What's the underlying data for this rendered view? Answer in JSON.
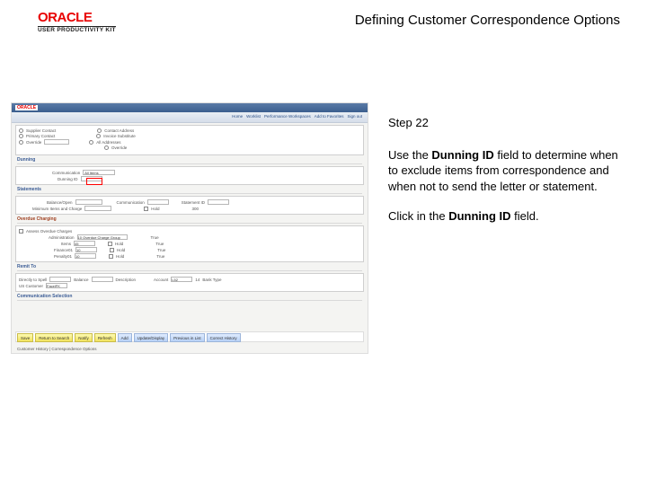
{
  "header": {
    "logo_text": "ORACLE",
    "upk_text": "USER PRODUCTIVITY KIT",
    "page_title": "Defining Customer Correspondence Options"
  },
  "screenshot": {
    "oracle_mini": "ORACLE",
    "nav": [
      "Home",
      "Worklist",
      "Performance Workspaces",
      "Add to Favorites",
      "Sign out"
    ],
    "opts": {
      "supplier_contact": "Supplier Contact",
      "primary_contact": "Primary Contact",
      "override": "Override",
      "contact_address": "Contact Address",
      "invoice_substitute": "Invoice Substitute",
      "all_addresses": "All Addresses",
      "override2": "Override"
    },
    "sect_dunning": "Dunning",
    "dunning": {
      "comm_label": "Communication",
      "comm_value": "All Items",
      "dunning_id_label": "Dunning ID"
    },
    "sect_statements": "Statements",
    "statements": {
      "balance_label": "Balance/Open",
      "comm_label": "Communication",
      "statement_id_label": "Statement ID",
      "items_label": "Minimum Items and Charge",
      "hold_label": "Hold",
      "hold_value": "300"
    },
    "sect_overdue": "Overdue Charging",
    "overdue": {
      "assess_label": "Assess Overdue Charges",
      "admin_label": "Administration",
      "admin_value": "10 Overdue Charge Group",
      "true1": "True",
      "items_label": "Items",
      "items_v": "45",
      "hold": "Hold",
      "true2": "True",
      "finance_label": "Finance01",
      "finance_v": "10",
      "hold2": "Hold",
      "true3": "True",
      "penalty_label": "Penalty01",
      "penalty_v": "10",
      "hold3": "Hold",
      "true4": "True"
    },
    "sect_remit": "Remit To",
    "remit": {
      "directly_label": "Directly to Spell",
      "bal_label": "Balance",
      "desc_label": "Description",
      "account_label": "Account",
      "acct_v": "L52",
      "acct_v2": "14",
      "bank_label": "Bank Type",
      "us_label": "US Customer",
      "us_value": "FacelFK"
    },
    "sect_corr": "Communication Selection",
    "footer_bar": {
      "save": "Save",
      "return": "Return to Search",
      "notify": "Notify",
      "refresh": "Refresh",
      "add": "Add",
      "update": "Update/Display",
      "prev": "Previous in List",
      "correct": "Correct History"
    },
    "footer_text": "Customer History | Correspondence Options"
  },
  "instructions": {
    "step": "Step 22",
    "para1_a": "Use the ",
    "para1_b": "Dunning ID",
    "para1_c": " field to determine when to exclude items from correspondence and when not to send the letter or statement.",
    "para2_a": "Click in the ",
    "para2_b": "Dunning ID",
    "para2_c": " field."
  }
}
